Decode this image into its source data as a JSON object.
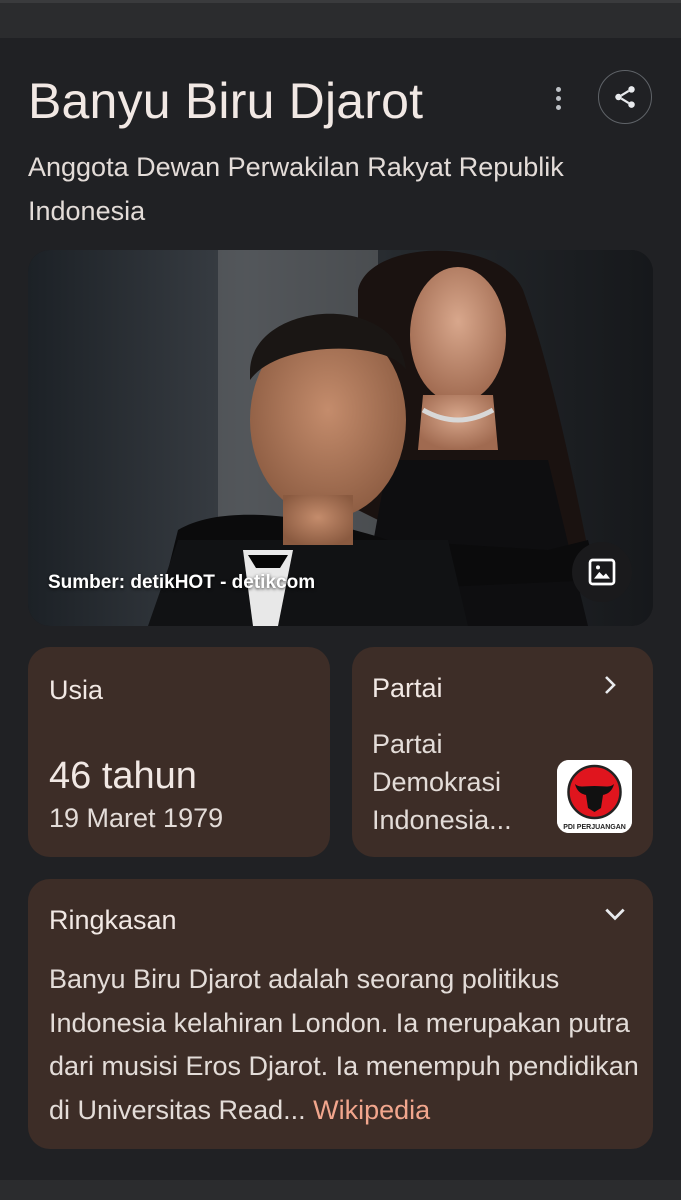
{
  "entity": {
    "name": "Banyu Biru Djarot",
    "description": "Anggota Dewan Perwakilan Rakyat Republik Indonesia"
  },
  "image": {
    "source_caption": "Sumber: detikHOT - detikcom"
  },
  "age": {
    "label": "Usia",
    "value": "46 tahun",
    "birth_date": "19 Maret 1979"
  },
  "party": {
    "label": "Partai",
    "name": "Partai Demokrasi Indonesia...",
    "logo_text": "PDI PERJUANGAN"
  },
  "summary": {
    "label": "Ringkasan",
    "text": "Banyu Biru Djarot adalah seorang politikus Indonesia kelahiran London. Ia merupakan putra dari musisi Eros Djarot. Ia menempuh pendidikan di Universitas Read",
    "ellipsis": "...",
    "source_link": "Wikipedia"
  },
  "icons": {
    "more": "more-vert-icon",
    "share": "share-icon",
    "image": "image-icon",
    "chevron_right": "chevron-right-icon",
    "chevron_down": "chevron-down-icon"
  },
  "colors": {
    "background": "#202124",
    "card": "#3d2d27",
    "link": "#f2a68d",
    "logo_red": "#e0151e"
  }
}
